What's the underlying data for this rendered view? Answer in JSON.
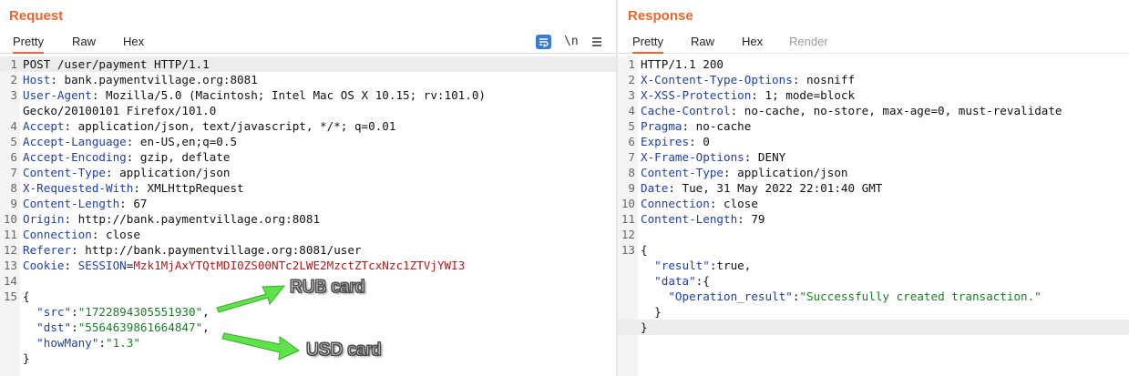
{
  "request": {
    "title": "Request",
    "tabs": [
      "Pretty",
      "Raw",
      "Hex"
    ],
    "active_tab": "Pretty",
    "tool_newline": "\\n",
    "lines": [
      {
        "n": "1",
        "parts": [
          {
            "t": "POST /user/payment HTTP/1.1",
            "c": ""
          }
        ],
        "current": true
      },
      {
        "n": "2",
        "parts": [
          {
            "t": "Host",
            "c": "hn"
          },
          {
            "t": ": bank.paymentvillage.org:8081",
            "c": ""
          }
        ]
      },
      {
        "n": "3",
        "parts": [
          {
            "t": "User-Agent",
            "c": "hn"
          },
          {
            "t": ": Mozilla/5.0 (Macintosh; Intel Mac OS X 10.15; rv:101.0)",
            "c": ""
          }
        ]
      },
      {
        "n": "",
        "parts": [
          {
            "t": "Gecko/20100101 Firefox/101.0",
            "c": ""
          }
        ]
      },
      {
        "n": "4",
        "parts": [
          {
            "t": "Accept",
            "c": "hn"
          },
          {
            "t": ": application/json, text/javascript, */*; q=0.01",
            "c": ""
          }
        ]
      },
      {
        "n": "5",
        "parts": [
          {
            "t": "Accept-Language",
            "c": "hn"
          },
          {
            "t": ": en-US,en;q=0.5",
            "c": ""
          }
        ]
      },
      {
        "n": "6",
        "parts": [
          {
            "t": "Accept-Encoding",
            "c": "hn"
          },
          {
            "t": ": gzip, deflate",
            "c": ""
          }
        ]
      },
      {
        "n": "7",
        "parts": [
          {
            "t": "Content-Type",
            "c": "hn"
          },
          {
            "t": ": application/json",
            "c": ""
          }
        ]
      },
      {
        "n": "8",
        "parts": [
          {
            "t": "X-Requested-With",
            "c": "hn"
          },
          {
            "t": ": XMLHttpRequest",
            "c": ""
          }
        ]
      },
      {
        "n": "9",
        "parts": [
          {
            "t": "Content-Length",
            "c": "hn"
          },
          {
            "t": ": 67",
            "c": ""
          }
        ]
      },
      {
        "n": "10",
        "parts": [
          {
            "t": "Origin",
            "c": "hn"
          },
          {
            "t": ": http://bank.paymentvillage.org:8081",
            "c": ""
          }
        ]
      },
      {
        "n": "11",
        "parts": [
          {
            "t": "Connection",
            "c": "hn"
          },
          {
            "t": ": close",
            "c": ""
          }
        ]
      },
      {
        "n": "12",
        "parts": [
          {
            "t": "Referer",
            "c": "hn"
          },
          {
            "t": ": http://bank.paymentvillage.org:8081/user",
            "c": ""
          }
        ]
      },
      {
        "n": "13",
        "parts": [
          {
            "t": "Cookie",
            "c": "hn"
          },
          {
            "t": ": ",
            "c": ""
          },
          {
            "t": "SESSION",
            "c": "ck"
          },
          {
            "t": "=",
            "c": ""
          },
          {
            "t": "Mzk1MjAxYTQtMDI0ZS00NTc2LWE2MzctZTcxNzc1ZTVjYWI3",
            "c": "cv"
          }
        ]
      },
      {
        "n": "14",
        "parts": [
          {
            "t": "",
            "c": ""
          }
        ]
      },
      {
        "n": "15",
        "parts": [
          {
            "t": "{",
            "c": ""
          }
        ]
      },
      {
        "n": "",
        "parts": [
          {
            "t": "  ",
            "c": ""
          },
          {
            "t": "\"src\"",
            "c": "js"
          },
          {
            "t": ":",
            "c": ""
          },
          {
            "t": "\"1722894305551930\"",
            "c": "jv"
          },
          {
            "t": ",",
            "c": ""
          }
        ]
      },
      {
        "n": "",
        "parts": [
          {
            "t": "  ",
            "c": ""
          },
          {
            "t": "\"dst\"",
            "c": "js"
          },
          {
            "t": ":",
            "c": ""
          },
          {
            "t": "\"5564639861664847\"",
            "c": "jv"
          },
          {
            "t": ",",
            "c": ""
          }
        ]
      },
      {
        "n": "",
        "parts": [
          {
            "t": "  ",
            "c": ""
          },
          {
            "t": "\"howMany\"",
            "c": "js"
          },
          {
            "t": ":",
            "c": ""
          },
          {
            "t": "\"1.3\"",
            "c": "jv"
          }
        ]
      },
      {
        "n": "",
        "parts": [
          {
            "t": "}",
            "c": ""
          }
        ]
      }
    ],
    "annotations": {
      "rub": "RUB card",
      "usd": "USD card"
    }
  },
  "response": {
    "title": "Response",
    "tabs": [
      "Pretty",
      "Raw",
      "Hex",
      "Render"
    ],
    "active_tab": "Pretty",
    "lines": [
      {
        "n": "1",
        "parts": [
          {
            "t": "HTTP/1.1 200",
            "c": ""
          }
        ]
      },
      {
        "n": "2",
        "parts": [
          {
            "t": "X-Content-Type-Options",
            "c": "hn"
          },
          {
            "t": ": nosniff",
            "c": ""
          }
        ]
      },
      {
        "n": "3",
        "parts": [
          {
            "t": "X-XSS-Protection",
            "c": "hn"
          },
          {
            "t": ": 1; mode=block",
            "c": ""
          }
        ]
      },
      {
        "n": "4",
        "parts": [
          {
            "t": "Cache-Control",
            "c": "hn"
          },
          {
            "t": ": no-cache, no-store, max-age=0, must-revalidate",
            "c": ""
          }
        ]
      },
      {
        "n": "5",
        "parts": [
          {
            "t": "Pragma",
            "c": "hn"
          },
          {
            "t": ": no-cache",
            "c": ""
          }
        ]
      },
      {
        "n": "6",
        "parts": [
          {
            "t": "Expires",
            "c": "hn"
          },
          {
            "t": ": 0",
            "c": ""
          }
        ]
      },
      {
        "n": "7",
        "parts": [
          {
            "t": "X-Frame-Options",
            "c": "hn"
          },
          {
            "t": ": DENY",
            "c": ""
          }
        ]
      },
      {
        "n": "8",
        "parts": [
          {
            "t": "Content-Type",
            "c": "hn"
          },
          {
            "t": ": application/json",
            "c": ""
          }
        ]
      },
      {
        "n": "9",
        "parts": [
          {
            "t": "Date",
            "c": "hn"
          },
          {
            "t": ": Tue, 31 May 2022 22:01:40 GMT",
            "c": ""
          }
        ]
      },
      {
        "n": "10",
        "parts": [
          {
            "t": "Connection",
            "c": "hn"
          },
          {
            "t": ": close",
            "c": ""
          }
        ]
      },
      {
        "n": "11",
        "parts": [
          {
            "t": "Content-Length",
            "c": "hn"
          },
          {
            "t": ": 79",
            "c": ""
          }
        ]
      },
      {
        "n": "12",
        "parts": [
          {
            "t": "",
            "c": ""
          }
        ]
      },
      {
        "n": "13",
        "parts": [
          {
            "t": "{",
            "c": ""
          }
        ]
      },
      {
        "n": "",
        "parts": [
          {
            "t": "  ",
            "c": ""
          },
          {
            "t": "\"result\"",
            "c": "js"
          },
          {
            "t": ":true,",
            "c": ""
          }
        ]
      },
      {
        "n": "",
        "parts": [
          {
            "t": "  ",
            "c": ""
          },
          {
            "t": "\"data\"",
            "c": "js"
          },
          {
            "t": ":{",
            "c": ""
          }
        ]
      },
      {
        "n": "",
        "parts": [
          {
            "t": "    ",
            "c": ""
          },
          {
            "t": "\"Operation_result\"",
            "c": "js"
          },
          {
            "t": ":",
            "c": ""
          },
          {
            "t": "\"Successfully created transaction.\"",
            "c": "jv"
          }
        ]
      },
      {
        "n": "",
        "parts": [
          {
            "t": "  }",
            "c": ""
          }
        ]
      },
      {
        "n": "",
        "parts": [
          {
            "t": "}",
            "c": ""
          }
        ],
        "current": true
      }
    ]
  },
  "colors": {
    "accent": "#e8662d",
    "header_name": "#1f3fa6",
    "json_value": "#1a7d26",
    "cookie_value": "#b01b1b",
    "arrow": "#5fe34a"
  },
  "icons": {
    "wrap": "wrap-lines-icon",
    "menu": "hamburger-menu-icon",
    "arrow": "green-arrow-icon"
  }
}
